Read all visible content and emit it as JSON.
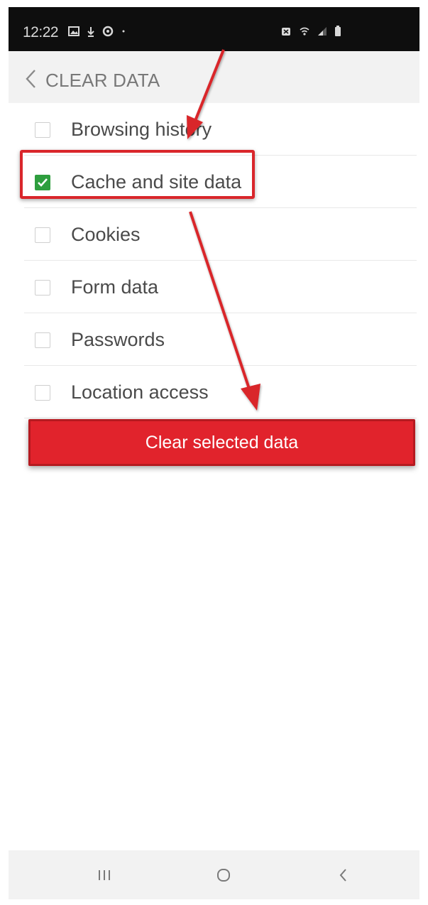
{
  "status_bar": {
    "time": "12:22",
    "left_icons": [
      "gallery-icon",
      "download-icon",
      "sync-icon",
      "dot-icon"
    ],
    "right_icons": [
      "alarm-icon",
      "wifi-icon",
      "signal-icon",
      "battery-icon"
    ]
  },
  "header": {
    "back_icon": "chevron-left-icon",
    "title": "CLEAR DATA"
  },
  "options": [
    {
      "label": "Browsing history",
      "checked": false
    },
    {
      "label": "Cache and site data",
      "checked": true
    },
    {
      "label": "Cookies",
      "checked": false
    },
    {
      "label": "Form data",
      "checked": false
    },
    {
      "label": "Passwords",
      "checked": false
    },
    {
      "label": "Location access",
      "checked": false
    }
  ],
  "action": {
    "clear_label": "Clear selected data"
  },
  "annotation": {
    "highlighted_option": "Cache and site data",
    "highlight_color": "#d9262b"
  },
  "nav_bar": {
    "buttons": [
      "recent-apps-icon",
      "home-icon",
      "back-icon"
    ]
  },
  "colors": {
    "accent": "#e1232c",
    "checkbox_checked": "#2e9e3e",
    "header_bg": "#f2f2f2",
    "status_bar_bg": "#0e0e0e"
  }
}
